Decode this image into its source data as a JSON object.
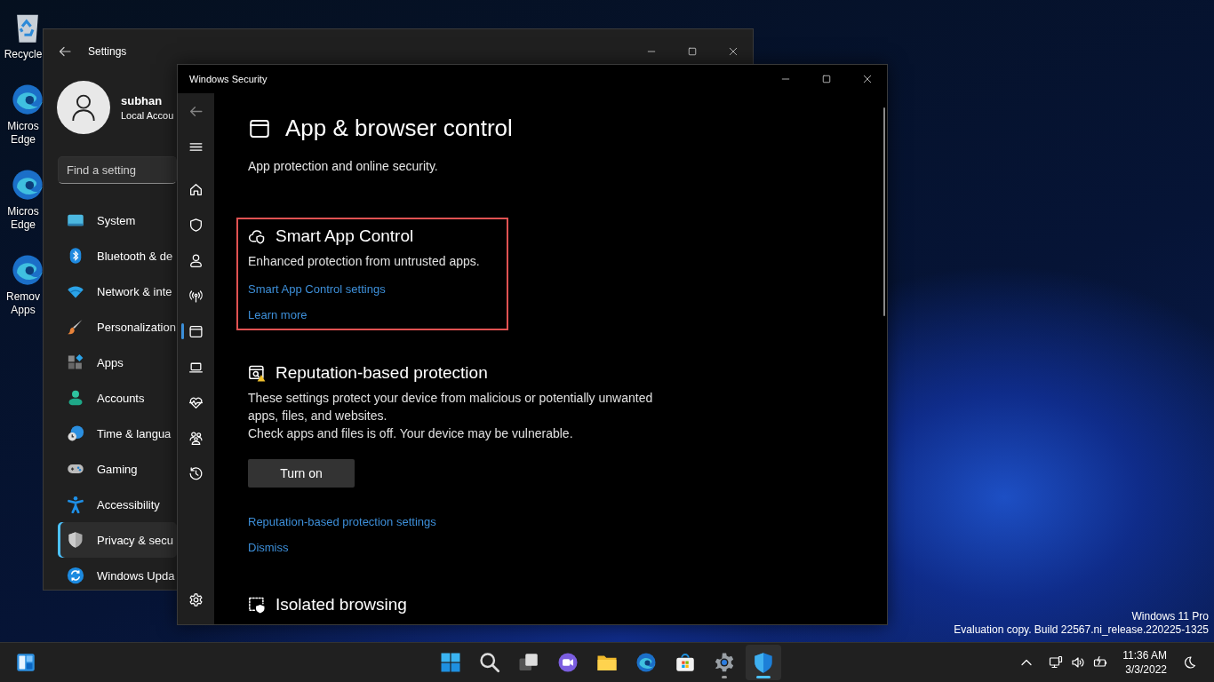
{
  "desktop": {
    "icons": [
      {
        "label": "Recycle"
      },
      {
        "label": "Micros Edge"
      },
      {
        "label": "Micros Edge"
      },
      {
        "label": "Remov Apps"
      }
    ],
    "watermark": [
      "Windows 11 Pro",
      "Evaluation copy. Build 22567.ni_release.220225-1325"
    ]
  },
  "settings_window": {
    "title": "Settings",
    "user": {
      "name": "subhan",
      "account": "Local Accou"
    },
    "search": {
      "placeholder": "Find a setting"
    },
    "nav": [
      {
        "label": "System",
        "selected": false
      },
      {
        "label": "Bluetooth & de",
        "selected": false
      },
      {
        "label": "Network & inte",
        "selected": false
      },
      {
        "label": "Personalization",
        "selected": false
      },
      {
        "label": "Apps",
        "selected": false
      },
      {
        "label": "Accounts",
        "selected": false
      },
      {
        "label": "Time & langua",
        "selected": false
      },
      {
        "label": "Gaming",
        "selected": false
      },
      {
        "label": "Accessibility",
        "selected": false
      },
      {
        "label": "Privacy & secu",
        "selected": true
      },
      {
        "label": "Windows Upda",
        "selected": false
      }
    ]
  },
  "security_window": {
    "title": "Windows Security",
    "rail": [
      {
        "selected": false
      },
      {
        "selected": false
      },
      {
        "selected": false
      },
      {
        "selected": false
      },
      {
        "selected": false
      },
      {
        "selected": false
      },
      {
        "selected": true
      },
      {
        "selected": false
      },
      {
        "selected": false
      },
      {
        "selected": false
      },
      {
        "selected": false
      },
      {
        "selected": false
      }
    ],
    "page": {
      "title": "App & browser control",
      "subtitle": "App protection and online security.",
      "sections": [
        {
          "title": "Smart App Control",
          "highlighted": true,
          "text": [
            "Enhanced protection from untrusted apps."
          ],
          "links": [
            "Smart App Control settings",
            "Learn more"
          ]
        },
        {
          "title": "Reputation-based protection",
          "highlighted": false,
          "text": [
            "These settings protect your device from malicious or potentially unwanted apps, files, and websites.",
            "Check apps and files is off. Your device may be vulnerable."
          ],
          "button": "Turn on",
          "links": [
            "Reputation-based protection settings",
            "Dismiss"
          ]
        },
        {
          "title": "Isolated browsing",
          "highlighted": false
        }
      ]
    }
  },
  "taskbar": {
    "apps": [
      {
        "running": false,
        "selected": false
      },
      {
        "running": false,
        "selected": false
      },
      {
        "running": false,
        "selected": false
      },
      {
        "running": false,
        "selected": false
      },
      {
        "running": false,
        "selected": false
      },
      {
        "running": false,
        "selected": false
      },
      {
        "running": false,
        "selected": false
      },
      {
        "running": true,
        "selected": false
      },
      {
        "running": true,
        "selected": true
      }
    ],
    "tray": {
      "time": "11:36 AM",
      "date": "3/3/2022"
    }
  }
}
